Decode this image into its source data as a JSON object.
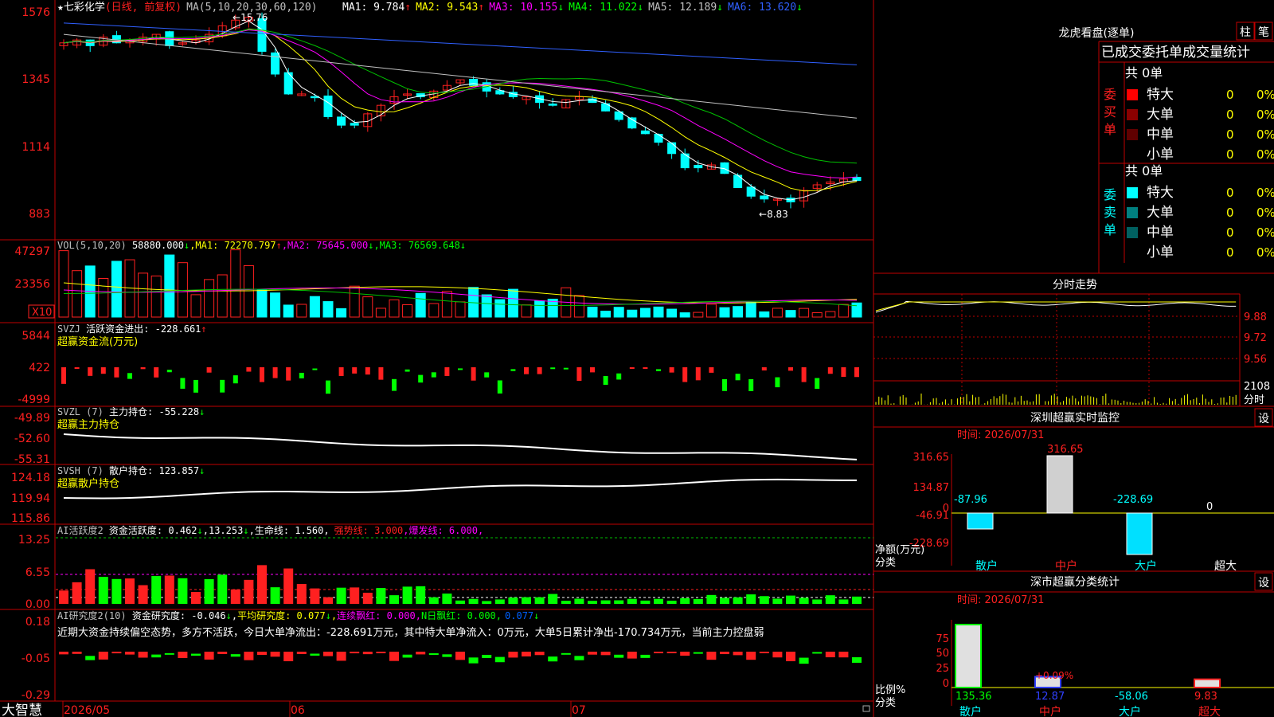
{
  "colors": {
    "bg": "#000000",
    "frame": "#c00000",
    "up": "#ff2020",
    "down": "#00e0e0",
    "yellow": "#ffff00",
    "magenta": "#ff00ff",
    "green": "#00d000",
    "white": "#ffffff",
    "cyan": "#00ffff"
  },
  "main": {
    "title": "★七彩化学",
    "period": "(日线, 前复权)",
    "ma_prefix": "MA(5,10,20,30,60,120)",
    "ma": [
      {
        "name": "MA1",
        "value": "9.784",
        "arrow": "↑",
        "color": "#ffffff"
      },
      {
        "name": "MA2",
        "value": "9.543",
        "arrow": "↑",
        "color": "#ffff00"
      },
      {
        "name": "MA3",
        "value": "10.155",
        "arrow": "↓",
        "color": "#ff00ff"
      },
      {
        "name": "MA4",
        "value": "11.022",
        "arrow": "↓",
        "color": "#00ff00"
      },
      {
        "name": "MA5",
        "value": "12.189",
        "arrow": "↓",
        "color": "#c0c0c0"
      },
      {
        "name": "MA6",
        "value": "13.620",
        "arrow": "↓",
        "color": "#3060ff"
      }
    ],
    "axis": [
      "1576",
      "1345",
      "1114",
      "883"
    ],
    "high_label": "15.76",
    "low_label": "8.83"
  },
  "vol": {
    "prefix": "VOL(5,10,20)",
    "value": "58880.000",
    "arrow": "↓",
    "ma1": "72270.797",
    "ma2": "75645.000",
    "ma3": "76569.648",
    "axis": [
      "47297",
      "23356"
    ],
    "unit": "X10"
  },
  "svzj": {
    "prefix": "SVZJ",
    "label": "活跃资金进出:",
    "value": "-228.661",
    "arrow": "↑",
    "sub": "超赢资金流(万元)",
    "axis": [
      "5844",
      "422",
      "-4999"
    ]
  },
  "svzl": {
    "prefix": "SVZL (7)",
    "label": "主力持仓:",
    "value": "-55.228",
    "arrow": "↓",
    "sub": "超赢主力持仓",
    "axis": [
      "-49.89",
      "-52.60",
      "-55.31"
    ]
  },
  "svsh": {
    "prefix": "SVSH (7)",
    "label": "散户持仓:",
    "value": "123.857",
    "arrow": "↓",
    "sub": "超赢散户持仓",
    "axis": [
      "124.18",
      "119.94",
      "115.86"
    ]
  },
  "ai1": {
    "prefix": "AI活跃度2",
    "label": "资金活跃度:",
    "value": "0.462",
    "arrow": "↓",
    "v2": "13.253",
    "life": "生命线: 1.560",
    "strong": "强势线: 3.000",
    "burst": "爆发线: 6.000",
    "axis": [
      "13.25",
      "6.55",
      "0.00"
    ]
  },
  "ai2": {
    "prefix": "AI研究度2(10)",
    "label": "资金研究度:",
    "value": "-0.046",
    "arrow": "↓",
    "avg": "平均研究度: 0.077",
    "lx": "连续飘红: 0.000",
    "nr": "N日飘红: 0.000",
    "last": "0.077",
    "axis": [
      "0.18",
      "-0.05",
      "-0.29"
    ],
    "comment": "近期大资金持续偏空态势，多方不活跃，今日大单净流出：-228.691万元，其中特大单净流入：0万元，大单5日累计净出-170.734万元，当前主力控盘弱"
  },
  "bottom": {
    "app": "大智慧",
    "dates": [
      "2026/05",
      "06",
      "07"
    ]
  },
  "lhb": {
    "title": "龙虎看盘(逐单)",
    "btn1": "柱",
    "btn2": "笔",
    "header": "已成交委托单成交量统计",
    "buy": {
      "side": "委买单",
      "total": "共 0单",
      "rows": [
        {
          "label": "特大",
          "val": "0",
          "pct": "0%",
          "color": "#ff0000"
        },
        {
          "label": "大单",
          "val": "0",
          "pct": "0%",
          "color": "#8b0000"
        },
        {
          "label": "中单",
          "val": "0",
          "pct": "0%",
          "color": "#600000"
        },
        {
          "label": "小单",
          "val": "0",
          "pct": "0%",
          "color": "#000000"
        }
      ]
    },
    "sell": {
      "side": "委卖单",
      "total": "共 0单",
      "rows": [
        {
          "label": "特大",
          "val": "0",
          "pct": "0%",
          "color": "#00ffff"
        },
        {
          "label": "大单",
          "val": "0",
          "pct": "0%",
          "color": "#008080"
        },
        {
          "label": "中单",
          "val": "0",
          "pct": "0%",
          "color": "#006060"
        },
        {
          "label": "小单",
          "val": "0",
          "pct": "0%",
          "color": "#000000"
        }
      ]
    }
  },
  "intraday": {
    "title": "分时走势",
    "axis": [
      "9.88",
      "9.72",
      "9.56"
    ],
    "vol": "2108",
    "vol_unit": "分时"
  },
  "monitor": {
    "title": "深圳超赢实时监控",
    "btn": "设",
    "time": "时间: 2026/07/31",
    "axis": [
      "316.65",
      "134.87",
      "0",
      "-46.91",
      "-228.69"
    ],
    "unit": "净额(万元)",
    "cat_label": "分类",
    "values": [
      {
        "cat": "散户",
        "val": "-87.96",
        "num": -87.96
      },
      {
        "cat": "中户",
        "val": "316.65",
        "num": 316.65
      },
      {
        "cat": "大户",
        "val": "-228.69",
        "num": -228.69
      },
      {
        "cat": "超大",
        "val": "0",
        "num": 0
      }
    ]
  },
  "class": {
    "title": "深市超赢分类统计",
    "btn": "设",
    "time": "时间: 2026/07/31",
    "axis": [
      "75",
      "50",
      "25",
      "0"
    ],
    "unit": "比例%",
    "cat_label": "分类",
    "values": [
      {
        "cat": "散户",
        "val": "135.36",
        "num": 135.36
      },
      {
        "cat": "中户",
        "val": "12.87",
        "num": 12.87
      },
      {
        "cat": "大户",
        "val": "-58.06",
        "num": -58.06
      },
      {
        "cat": "超大",
        "val": "9.83",
        "num": 9.83
      }
    ],
    "note": "+0.09%"
  }
}
